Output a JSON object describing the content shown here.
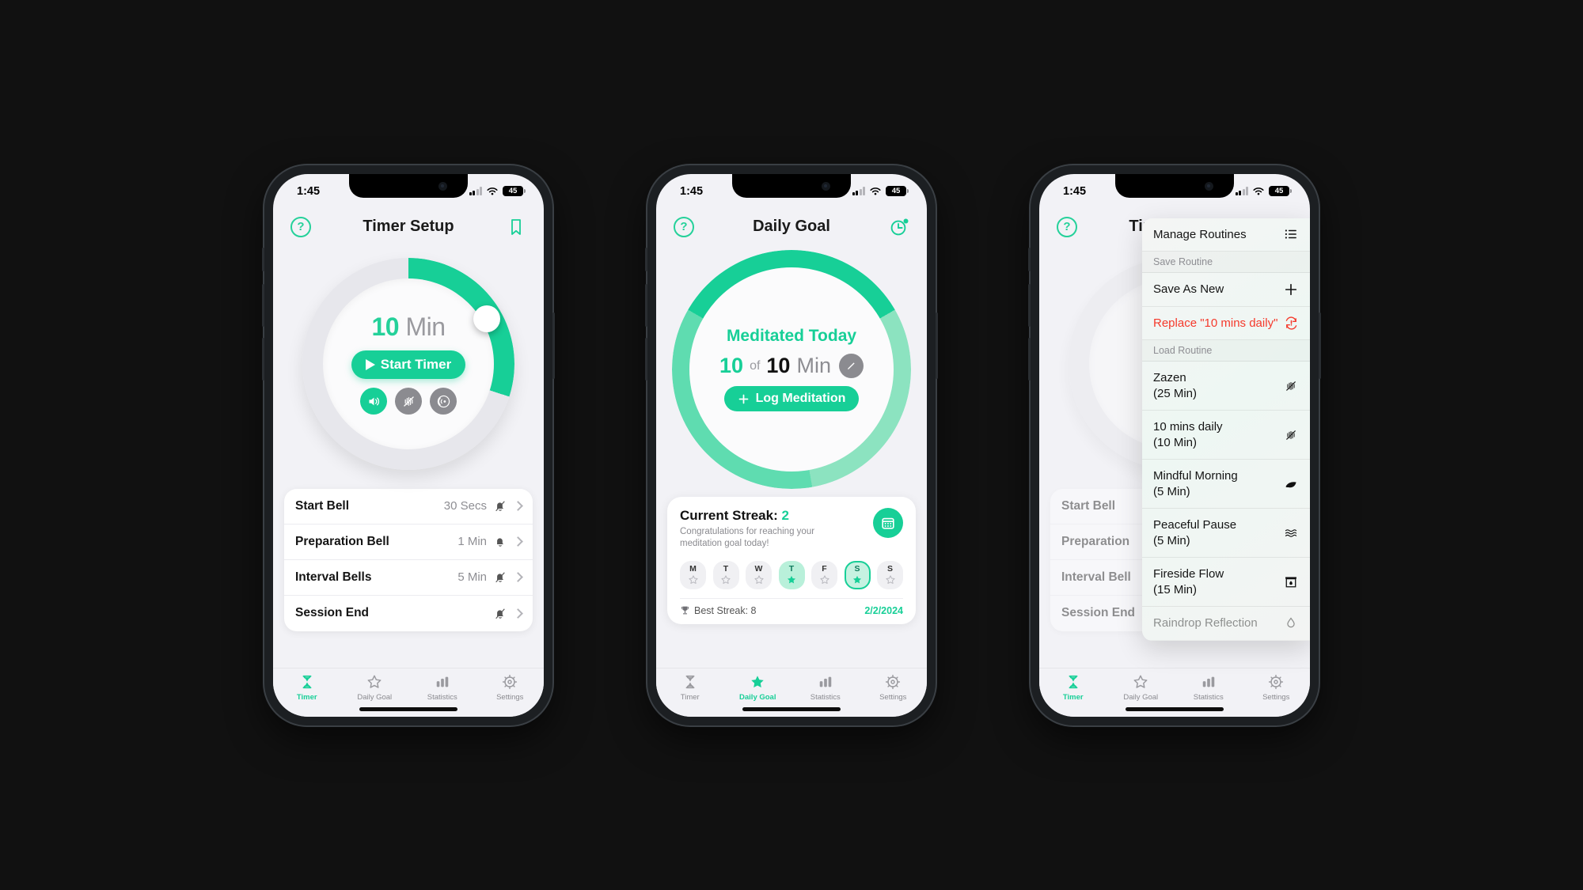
{
  "status_bar": {
    "time": "1:45",
    "battery": "45",
    "wifi_icon": "wifi-icon",
    "signal_icon": "cellular-signal-icon"
  },
  "brand": {
    "accent": "#17cf97",
    "accent_light": "#5fdcb0",
    "danger": "#f5392b",
    "track": "#e7e7ec",
    "muted": "#8e8e93"
  },
  "phone1": {
    "nav": {
      "title": "Timer Setup",
      "help_icon": "question-mark-circle-icon",
      "right_icon": "bookmark-icon"
    },
    "dial": {
      "value": "10",
      "unit": "Min",
      "progress_percent": 30,
      "knob_icon": "dial-knob-handle"
    },
    "start_button": {
      "label": "Start Timer",
      "icon": "play-icon"
    },
    "sound_buttons": [
      {
        "name": "sound-on-button",
        "icon": "speaker-wave-icon",
        "state": "on"
      },
      {
        "name": "vibration-off-button",
        "icon": "vibration-off-icon",
        "state": "off"
      },
      {
        "name": "ambient-sound-button",
        "icon": "broadcast-icon",
        "state": "off"
      }
    ],
    "settings_rows": [
      {
        "label": "Start Bell",
        "value": "30 Secs",
        "bell_icon": "bell-slash-icon"
      },
      {
        "label": "Preparation Bell",
        "value": "1 Min",
        "bell_icon": "bell-icon"
      },
      {
        "label": "Interval Bells",
        "value": "5 Min",
        "bell_icon": "bell-slash-icon"
      },
      {
        "label": "Session End",
        "value": "",
        "bell_icon": "bell-slash-icon"
      }
    ]
  },
  "phone2": {
    "nav": {
      "title": "Daily Goal",
      "help_icon": "question-mark-circle-icon",
      "right_icon": "history-clock-icon"
    },
    "goal": {
      "heading": "Meditated Today",
      "current": "10",
      "of": "of",
      "total": "10",
      "unit": "Min",
      "edit_icon": "pencil-edit-icon",
      "log_button": {
        "label": "Log Meditation",
        "icon": "plus-icon"
      },
      "progress_percent": 100
    },
    "streak": {
      "title_label": "Current Streak:",
      "title_value": "2",
      "subtitle": "Congratulations for reaching your meditation goal today!",
      "calendar_icon": "calendar-icon",
      "days": [
        {
          "letter": "M",
          "state": "empty"
        },
        {
          "letter": "T",
          "state": "empty"
        },
        {
          "letter": "W",
          "state": "empty"
        },
        {
          "letter": "T",
          "state": "filled"
        },
        {
          "letter": "F",
          "state": "empty"
        },
        {
          "letter": "S",
          "state": "today"
        },
        {
          "letter": "S",
          "state": "empty"
        }
      ],
      "best_icon": "trophy-icon",
      "best_label": "Best Streak: 8",
      "date": "2/2/2024"
    }
  },
  "phone3": {
    "nav": {
      "title": "Timer Setup",
      "help_icon": "question-mark-circle-icon",
      "right_icon": "bookmark-icon"
    },
    "menu": {
      "header": {
        "label": "Manage Routines",
        "icon": "list-bullet-icon"
      },
      "save_section_label": "Save Routine",
      "save_as_new": {
        "label": "Save As New",
        "icon": "plus-icon"
      },
      "replace": {
        "label": "Replace \"10 mins daily\"",
        "icon": "replace-warning-icon"
      },
      "load_section_label": "Load Routine",
      "routines": [
        {
          "name": "Zazen",
          "duration": "(25 Min)",
          "icon": "vibration-off-icon"
        },
        {
          "name": "10 mins daily",
          "duration": "(10 Min)",
          "icon": "vibration-off-icon"
        },
        {
          "name": "Mindful Morning",
          "duration": "(5 Min)",
          "icon": "leaf-icon"
        },
        {
          "name": "Peaceful Pause",
          "duration": "(5 Min)",
          "icon": "waves-icon"
        },
        {
          "name": "Fireside Flow",
          "duration": "(15 Min)",
          "icon": "fireplace-icon"
        },
        {
          "name": "Raindrop Reflection",
          "duration": "",
          "icon": "raindrop-icon"
        }
      ]
    },
    "settings_rows": [
      {
        "label": "Start Bell"
      },
      {
        "label": "Preparation"
      },
      {
        "label": "Interval Bell"
      },
      {
        "label": "Session End"
      }
    ]
  },
  "tabs": [
    {
      "label": "Timer",
      "icon": "hourglass-icon"
    },
    {
      "label": "Daily Goal",
      "icon": "star-icon"
    },
    {
      "label": "Statistics",
      "icon": "bar-chart-icon"
    },
    {
      "label": "Settings",
      "icon": "gear-icon"
    }
  ]
}
